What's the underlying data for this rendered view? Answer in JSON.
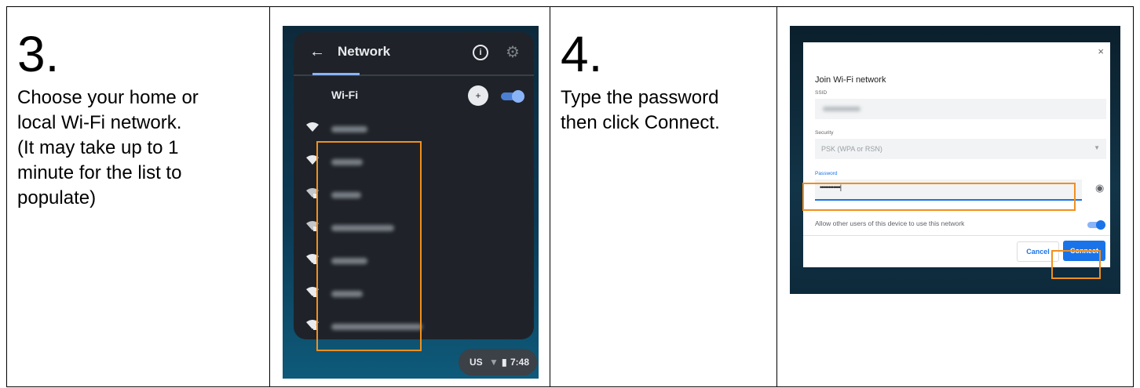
{
  "step3": {
    "number": "3.",
    "text": "Choose your home or\nlocal Wi-Fi network.\n(It may take up to 1\nminute for the list to\npopulate)"
  },
  "network_panel": {
    "back_icon": "arrow-left-icon",
    "title": "Network",
    "info_icon": "info-icon",
    "settings_icon": "gear-icon",
    "wifi_label": "Wi-Fi",
    "add_network_icon": "add-wifi-icon",
    "wifi_toggle_on": true,
    "networks": [
      {
        "name_blurred": true,
        "secured": false
      },
      {
        "name_blurred": true,
        "secured": false
      },
      {
        "name_blurred": true,
        "secured": true
      },
      {
        "name_blurred": true,
        "secured": true
      },
      {
        "name_blurred": true,
        "secured": true
      },
      {
        "name_blurred": true,
        "secured": true
      },
      {
        "name_blurred": true,
        "secured": true
      }
    ],
    "tray": {
      "locale": "US",
      "time": "7:48"
    }
  },
  "step4": {
    "number": "4.",
    "text": "Type the password\nthen click Connect."
  },
  "join_dialog": {
    "close_label": "×",
    "title": "Join Wi-Fi network",
    "ssid_label": "SSID",
    "security_label": "Security",
    "security_value": "PSK (WPA or RSN)",
    "password_label": "Password",
    "password_value": "••••••••••••|",
    "allow_text": "Allow other users of this device to use this network",
    "cancel_label": "Cancel",
    "connect_label": "Connect"
  },
  "colors": {
    "highlight": "#f0901e",
    "accent": "#1a73e8"
  }
}
